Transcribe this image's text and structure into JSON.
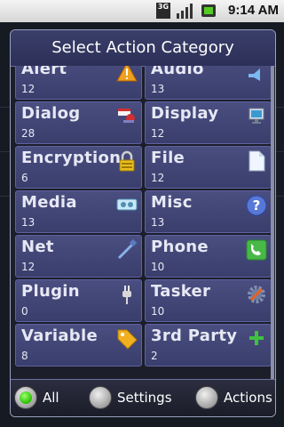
{
  "status_bar": {
    "network": "3G",
    "time": "9:14 AM",
    "icons": [
      "3g-icon",
      "signal-icon",
      "battery-icon"
    ]
  },
  "dialog": {
    "title": "Select Action Category",
    "categories": [
      {
        "name": "Alert",
        "count": "12",
        "icon": "warning-icon"
      },
      {
        "name": "Audio",
        "count": "13",
        "icon": "speaker-icon"
      },
      {
        "name": "Dialog",
        "count": "28",
        "icon": "dialog-icon"
      },
      {
        "name": "Display",
        "count": "12",
        "icon": "monitor-icon"
      },
      {
        "name": "Encryption",
        "count": "6",
        "icon": "padlock-icon"
      },
      {
        "name": "File",
        "count": "12",
        "icon": "file-icon"
      },
      {
        "name": "Media",
        "count": "13",
        "icon": "media-icon"
      },
      {
        "name": "Misc",
        "count": "13",
        "icon": "question-icon"
      },
      {
        "name": "Net",
        "count": "12",
        "icon": "cable-icon"
      },
      {
        "name": "Phone",
        "count": "10",
        "icon": "phone-icon"
      },
      {
        "name": "Plugin",
        "count": "0",
        "icon": "plug-icon"
      },
      {
        "name": "Tasker",
        "count": "10",
        "icon": "gear-icon"
      },
      {
        "name": "Variable",
        "count": "8",
        "icon": "tag-icon"
      },
      {
        "name": "3rd Party",
        "count": "2",
        "icon": "plus-icon"
      }
    ],
    "filters": [
      {
        "label": "All",
        "selected": true
      },
      {
        "label": "Settings",
        "selected": false
      },
      {
        "label": "Actions",
        "selected": false
      }
    ]
  },
  "colors": {
    "title_bar": "#2c3058",
    "cell": "#44487a",
    "accent_green": "#28c000",
    "warning_orange": "#f0a020"
  }
}
